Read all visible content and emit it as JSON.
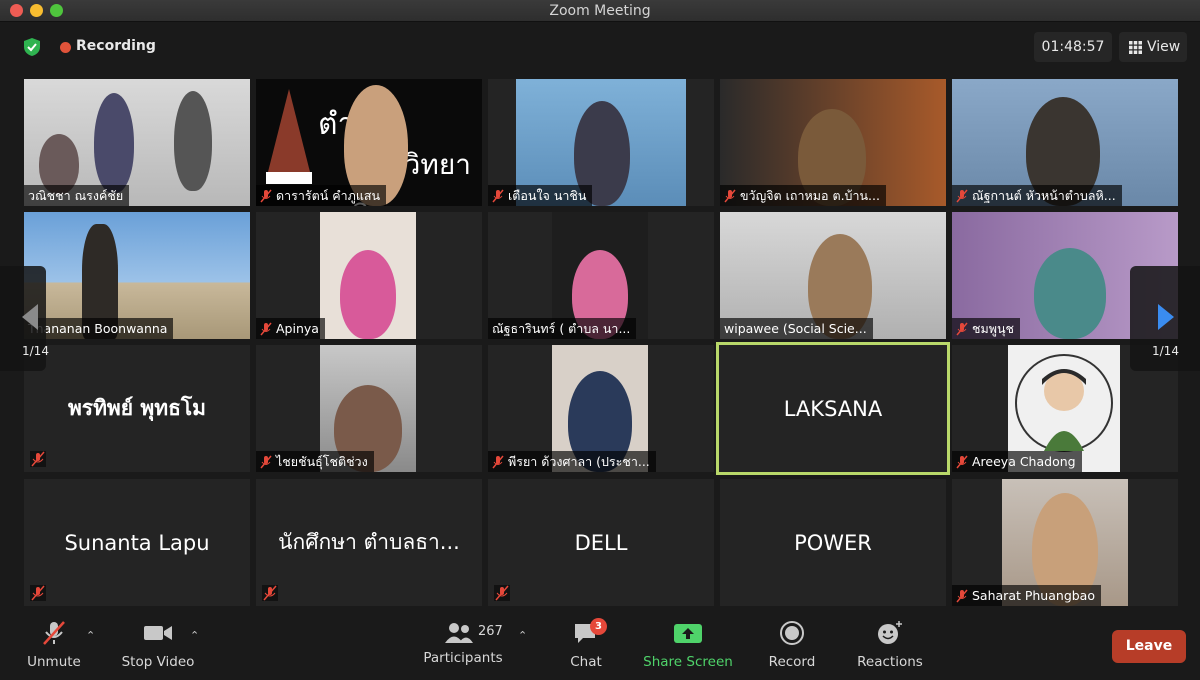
{
  "window": {
    "title": "Zoom Meeting"
  },
  "status": {
    "recording_label": "Recording",
    "timer": "01:48:57",
    "view_label": "View"
  },
  "pagination": {
    "left_page": "1/14",
    "right_page": "1/14"
  },
  "tiles": [
    {
      "name": "วณิชชา ณรงค์ชัย",
      "type": "video"
    },
    {
      "name": "ดารารัตน์ คำภูแสน",
      "type": "video"
    },
    {
      "name": "เตือนใจ นาชิน",
      "type": "video"
    },
    {
      "name": "ขวัญจิต เถาหมอ ต.บ้าน...",
      "type": "video"
    },
    {
      "name": "ณัฐกานต์ หัวหน้าตำบลหิ...",
      "type": "video"
    },
    {
      "name": "Thananan  Boonwanna",
      "type": "video"
    },
    {
      "name": "Apinya",
      "type": "video"
    },
    {
      "name": "ณัฐธารินทร์ ( ตำบล  นา...",
      "type": "video"
    },
    {
      "name": "wipawee (Social Scie...",
      "type": "video"
    },
    {
      "name": "ชมพูนุช",
      "type": "video"
    },
    {
      "name": "พรทิพย์ พุทธโม",
      "type": "name"
    },
    {
      "name": "ไชยชันธุ์โชติช่วง",
      "type": "video"
    },
    {
      "name": "พีรยา ด้วงศาลา (ประชา...",
      "type": "video"
    },
    {
      "name": "LAKSANA",
      "type": "name"
    },
    {
      "name": "Areeya Chadong",
      "type": "video"
    },
    {
      "name": "Sunanta Lapu",
      "type": "name"
    },
    {
      "name": "นักศึกษา ตำบลธา...",
      "type": "name"
    },
    {
      "name": "DELL",
      "type": "name"
    },
    {
      "name": "POWER",
      "type": "name"
    },
    {
      "name": "Saharat Phuangbao",
      "type": "video"
    }
  ],
  "overlay_text": {
    "tile2_a": "ตำบล",
    "tile2_b": "มหาวิทยาลั"
  },
  "toolbar": {
    "unmute": "Unmute",
    "stop_video": "Stop Video",
    "participants": "Participants",
    "participants_count": "267",
    "chat": "Chat",
    "chat_badge": "3",
    "share_screen": "Share Screen",
    "record": "Record",
    "reactions": "Reactions",
    "leave": "Leave"
  },
  "icons": [
    "shield-icon",
    "grid-icon",
    "mic-muted-icon",
    "video-camera-icon",
    "participants-icon",
    "chat-icon",
    "share-screen-icon",
    "record-icon",
    "reactions-icon",
    "chevron-up-icon",
    "chevron-left-icon",
    "chevron-right-icon"
  ],
  "colors": {
    "accent_green": "#4fd36a",
    "active_border": "#b9d86a",
    "leave_red": "#b73d28",
    "muted_red": "#e5483a"
  }
}
